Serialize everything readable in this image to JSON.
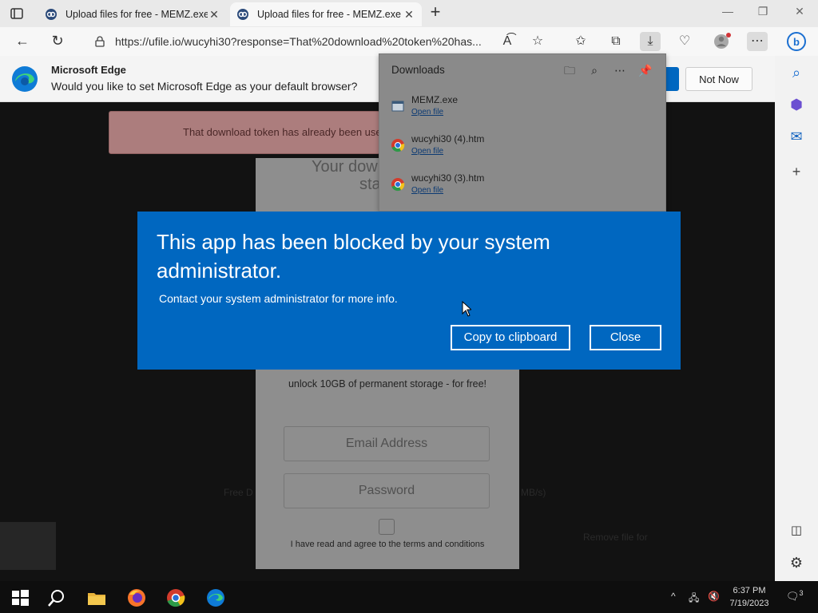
{
  "browser": {
    "tabs": [
      {
        "title": "Upload files for free - MEMZ.exe"
      },
      {
        "title": "Upload files for free - MEMZ.exe"
      }
    ],
    "url": "https://ufile.io/wucyhi30?response=That%20download%20token%20has..."
  },
  "banner": {
    "title": "Microsoft Edge",
    "message": "Would you like to set Microsoft Edge as your default browser?",
    "not_now": "Not Now"
  },
  "downloads": {
    "title": "Downloads",
    "items": [
      {
        "name": "MEMZ.exe",
        "action": "Open file"
      },
      {
        "name": "wucyhi30 (4).htm",
        "action": "Open file"
      },
      {
        "name": "wucyhi30 (3).htm",
        "action": "Open file"
      }
    ]
  },
  "page": {
    "alert": "That download token has already been use",
    "heading1": "Your dow",
    "heading2": "sta",
    "promo": "unlock 10GB of permanent storage - for free!",
    "email_placeholder": "Email Address",
    "password_placeholder": "Password",
    "terms": "I have read and agree to the terms and conditions",
    "faint_left": "Free D",
    "faint_right": "MB/s)",
    "faint_bottom": "Remove file for"
  },
  "dialog": {
    "title": "This app has been blocked by your system administrator.",
    "subtitle": "Contact your system administrator for more info.",
    "copy_label": "Copy to clipboard",
    "close_label": "Close"
  },
  "taskbar": {
    "time": "6:37 PM",
    "date": "7/19/2023",
    "notifications": "3"
  },
  "colors": {
    "dialog_blue": "#0067c0",
    "edge_blue": "#0078d4"
  }
}
